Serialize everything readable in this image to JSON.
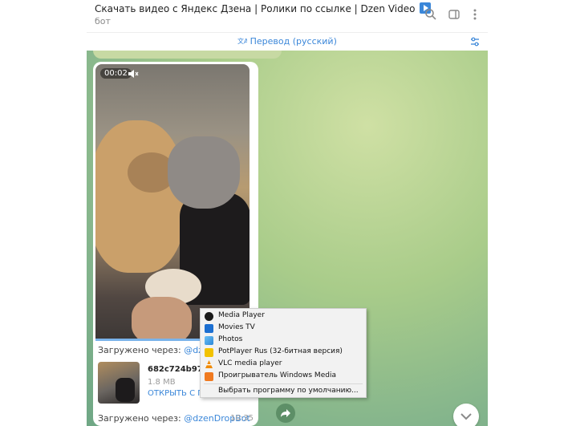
{
  "header": {
    "title": "Скачать видео с Яндекс Дзена | Ролики по ссылке | Dzen Video",
    "subtitle": "бот"
  },
  "translate": {
    "label": "Перевод (русский)"
  },
  "message": {
    "video_time": "00:02",
    "via_prefix": "Загружено через: ",
    "via_handle": "@dzenDropBot",
    "via_handle_cut": "@dzenDr",
    "file_name": "682c724b9776f",
    "file_size": "1.8 MB",
    "open_label": "ОТКРЫТЬ С ПОМОЩЬЮ",
    "time": "10:35"
  },
  "context_menu": {
    "items": [
      {
        "label": "Media Player",
        "icon": "media-player-icon",
        "color": "#1a1a1a"
      },
      {
        "label": "Movies  TV",
        "icon": "movies-tv-icon",
        "color": "#1c6fd1"
      },
      {
        "label": "Photos",
        "icon": "photos-icon",
        "color": "#2b88d8"
      },
      {
        "label": "PotPlayer Rus (32-битная версия)",
        "icon": "potplayer-icon",
        "color": "#f2c200"
      },
      {
        "label": "VLC media player",
        "icon": "vlc-icon",
        "color": "#f08a00"
      },
      {
        "label": "Проигрыватель Windows Media",
        "icon": "windows-media-icon",
        "color": "#f07a20"
      }
    ],
    "default_label": "Выбрать программу по умолчанию..."
  },
  "colors": {
    "accent": "#3b87d9",
    "chat_bg": "#a9cc8a"
  }
}
